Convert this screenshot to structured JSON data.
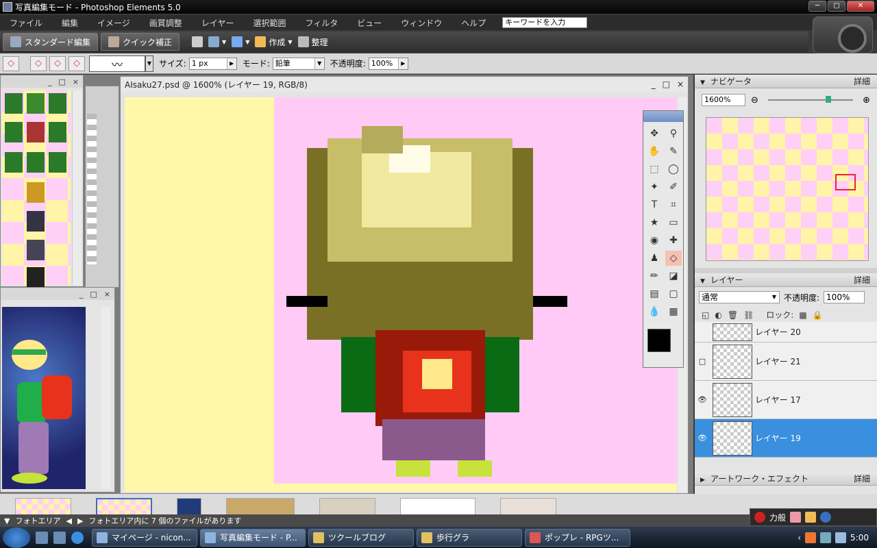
{
  "window": {
    "title": "写真編集モード - Photoshop Elements 5.0"
  },
  "menu": {
    "items": [
      "ファイル",
      "編集",
      "イメージ",
      "画質調整",
      "レイヤー",
      "選択範囲",
      "フィルタ",
      "ビュー",
      "ウィンドウ",
      "ヘルプ"
    ],
    "search_placeholder": "キーワードを入力"
  },
  "modebar": {
    "standard_tab": "スタンダード編集",
    "quick_tab": "クイック補正",
    "create_label": "作成",
    "organize_label": "整理"
  },
  "options": {
    "size_label": "サイズ:",
    "size_value": "1 px",
    "mode_label": "モード:",
    "mode_value": "鉛筆",
    "opacity_label": "不透明度:",
    "opacity_value": "100%"
  },
  "document": {
    "title": "AIsaku27.psd @ 1600% (レイヤー 19, RGB/8)"
  },
  "navigator": {
    "title": "ナビゲータ",
    "details": "詳細",
    "zoom": "1600%"
  },
  "layers": {
    "title": "レイヤー",
    "details": "詳細",
    "blend_mode": "通常",
    "opacity_label": "不透明度:",
    "opacity_value": "100%",
    "lock_label": "ロック:",
    "items": [
      {
        "name": "レイヤー 20",
        "visible": false,
        "selected": false
      },
      {
        "name": "レイヤー 21",
        "visible": false,
        "selected": false
      },
      {
        "name": "レイヤー 17",
        "visible": true,
        "selected": false
      },
      {
        "name": "レイヤー 19",
        "visible": true,
        "selected": true
      }
    ]
  },
  "effects": {
    "title": "アートワーク・エフェクト",
    "details": "詳細"
  },
  "photobin": {
    "label": "フォトエリア",
    "status": "フォトエリア内に 7 個のファイルがあります"
  },
  "taskbar": {
    "buttons": [
      "マイページ - nicon...",
      "写真編集モード - P...",
      "ツクールブログ",
      "歩行グラ",
      "ポップレ - RPGツ..."
    ],
    "active_index": 1,
    "clock": "5:00",
    "ime": "力般"
  },
  "colors": {
    "canvas_yellow": "#fff8ab",
    "canvas_pink": "#ffcbf6",
    "selection_blue": "#3a8fde",
    "foreground": "#000000"
  }
}
